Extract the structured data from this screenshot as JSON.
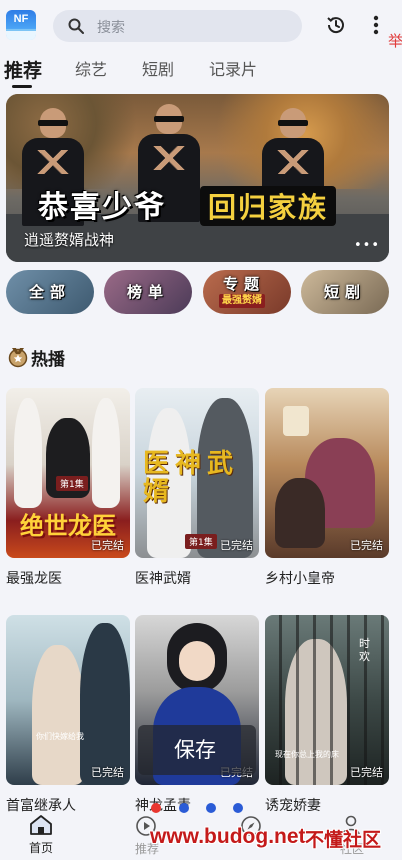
{
  "header": {
    "logo_text": "NF",
    "search_placeholder": "搜索",
    "edge_glyph": "举"
  },
  "tabs": [
    {
      "label": "推荐",
      "active": true
    },
    {
      "label": "综艺",
      "active": false
    },
    {
      "label": "短剧",
      "active": false
    },
    {
      "label": "记录片",
      "active": false
    }
  ],
  "banner": {
    "title_left": "恭喜少爷",
    "title_right": "回归家族",
    "caption": "逍遥赘婿战神",
    "more": "•••"
  },
  "categories": [
    {
      "label": "全部"
    },
    {
      "label": "榜单"
    },
    {
      "label": "专题",
      "sub": "最强赘婿"
    },
    {
      "label": "短剧"
    }
  ],
  "section": {
    "title": "热播",
    "icon": "medal-icon"
  },
  "dramas": [
    {
      "title": "最强龙医",
      "badge": "已完结",
      "poster_text": "绝世龙医",
      "episode": "第1集"
    },
    {
      "title": "医神武婿",
      "badge": "已完结",
      "poster_text": "医神武婿",
      "episode": "第1集"
    },
    {
      "title": "乡村小皇帝",
      "badge": "已完结"
    },
    {
      "title": "首富继承人",
      "badge": "已完结",
      "poster_caption": "你们快嫁给我"
    },
    {
      "title": "神龙孟青",
      "badge": "已完结"
    },
    {
      "title": "诱宠娇妻",
      "badge": "已完结",
      "poster_caption": "现在你总上我的床",
      "poster_side": "时 欢"
    }
  ],
  "overlay": {
    "save_label": "保存"
  },
  "bottom_nav": {
    "home_label": "首页",
    "ghost_labels": [
      "推荐",
      "社区"
    ]
  },
  "watermark": {
    "url": "www.budog.net",
    "site": "不懂社区"
  },
  "colors": {
    "accent_red": "#e8362f",
    "dot_blue": "#2a5bd6",
    "background": "#f3f4f9",
    "banner_title_yellow": "#f4d03f"
  }
}
